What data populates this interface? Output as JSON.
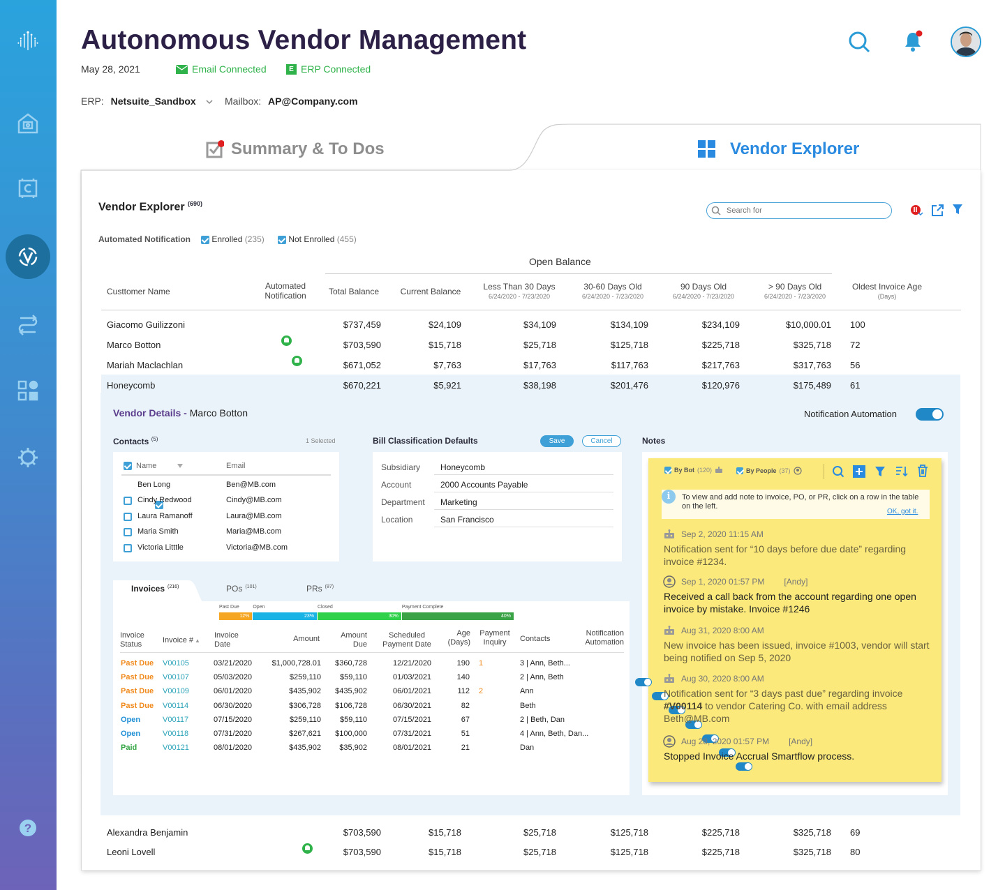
{
  "app": {
    "title": "Autonomous Vendor Management",
    "date": "May 28, 2021",
    "email_status": "Email Connected",
    "erp_status": "ERP Connected",
    "erp_badge": "E",
    "erp_label": "ERP:",
    "erp_value": "Netsuite_Sandbox",
    "mailbox_label": "Mailbox:",
    "mailbox_value": "AP@Company.com"
  },
  "tabs": {
    "summary": "Summary & To Dos",
    "vendor": "Vendor Explorer"
  },
  "explorer": {
    "title": "Vendor Explorer",
    "count": "(690)",
    "search_placeholder": "Search for",
    "filter_label": "Automated Notification",
    "enrolled": "Enrolled",
    "enrolled_count": "(235)",
    "not_enrolled": "Not Enrolled",
    "not_enrolled_count": "(455)",
    "group_header": "Open Balance",
    "columns": {
      "name": "Custtomer Name",
      "auto1": "Automated",
      "auto2": "Notification",
      "total": "Total Balance",
      "current": "Current Balance",
      "lt30": "Less Than 30 Days",
      "lt30_sub": "6/24/2020 - 7/23/2020",
      "d3060": "30-60 Days Old",
      "d3060_sub": "6/24/2020 - 7/23/2020",
      "d90": "90 Days Old",
      "d90_sub": "6/24/2020 - 7/23/2020",
      "gt90": "> 90 Days  Old",
      "gt90_sub": "6/24/2020 - 7/23/2020",
      "oldest": "Oldest Invoice Age",
      "oldest_sub": "(Days)"
    },
    "rows": [
      {
        "name": "Giacomo Guilizzoni",
        "auto": true,
        "total": "$737,459",
        "current": "$24,109",
        "lt30": "$34,109",
        "d3060": "$134,109",
        "d90": "$234,109",
        "gt90": "$10,000.01",
        "age": "100"
      },
      {
        "name": "Marco Botton",
        "auto": true,
        "total": "$703,590",
        "current": "$15,718",
        "lt30": "$25,718",
        "d3060": "$125,718",
        "d90": "$225,718",
        "gt90": "$325,718",
        "age": "72"
      },
      {
        "name": "Mariah Maclachlan",
        "auto": false,
        "total": "$671,052",
        "current": "$7,763",
        "lt30": "$17,763",
        "d3060": "$117,763",
        "d90": "$217,763",
        "gt90": "$317,763",
        "age": "56"
      },
      {
        "name": "Honeycomb",
        "auto": false,
        "total": "$670,221",
        "current": "$5,921",
        "lt30": "$38,198",
        "d3060": "$201,476",
        "d90": "$120,976",
        "gt90": "$175,489",
        "age": "61"
      }
    ],
    "rows_after": [
      {
        "name": "Alexandra Benjamin",
        "auto": true,
        "total": "$703,590",
        "current": "$15,718",
        "lt30": "$25,718",
        "d3060": "$125,718",
        "d90": "$225,718",
        "gt90": "$325,718",
        "age": "69"
      },
      {
        "name": "Leoni Lovell",
        "auto": false,
        "total": "$703,590",
        "current": "$15,718",
        "lt30": "$25,718",
        "d3060": "$125,718",
        "d90": "$225,718",
        "gt90": "$325,718",
        "age": "80"
      }
    ]
  },
  "details": {
    "title": "Vendor Details",
    "dash": " - ",
    "vendor": "Marco Botton",
    "automation_label": "Notification Automation",
    "contacts": {
      "title": "Contacts",
      "count": "(5)",
      "selected": "1 Selected",
      "col_name": "Name",
      "col_email": "Email",
      "items": [
        {
          "name": "Ben Long",
          "email": "Ben@MB.com",
          "checked": true
        },
        {
          "name": "Cindy Redwood",
          "email": "Cindy@MB.com",
          "checked": false
        },
        {
          "name": "Laura Ramanoff",
          "email": "Laura@MB.com",
          "checked": false
        },
        {
          "name": "Maria Smith",
          "email": "Maria@MB.com",
          "checked": false
        },
        {
          "name": "Victoria Litttle",
          "email": "Victoria@MB.com",
          "checked": false
        }
      ]
    },
    "bill": {
      "title": "Bill Classification Defaults",
      "save": "Save",
      "cancel": "Cancel",
      "fields": [
        {
          "label": "Subsidiary",
          "value": "Honeycomb"
        },
        {
          "label": "Account",
          "value": "2000 Accounts Payable"
        },
        {
          "label": "Department",
          "value": "Marketing"
        },
        {
          "label": "Location",
          "value": "San Francisco"
        }
      ]
    },
    "tabs": [
      {
        "label": "Invoices",
        "count": "(216)"
      },
      {
        "label": "POs",
        "count": "(101)"
      },
      {
        "label": "PRs",
        "count": "(87)"
      }
    ],
    "status_bar": [
      {
        "label": "Past Due",
        "value": "12%",
        "pct": 12,
        "color": "#f5a623"
      },
      {
        "label": "Open",
        "value": "23%",
        "pct": 23,
        "color": "#1ab3e6"
      },
      {
        "label": "Closed",
        "value": "30%",
        "pct": 30,
        "color": "#2fd14a"
      },
      {
        "label": "Payment Complete",
        "value": "40%",
        "pct": 40,
        "color": "#3aa345"
      }
    ],
    "inv_cols": {
      "status1": "Invoice",
      "status2": "Status",
      "num": "Invoice #",
      "date1": "Invoice",
      "date2": "Date",
      "amount": "Amount",
      "due1": "Amount",
      "due2": "Due",
      "sched1": "Scheduled",
      "sched2": "Payment Date",
      "age1": "Age",
      "age2": "(Days)",
      "inq1": "Payment",
      "inq2": "Inquiry",
      "contacts": "Contacts",
      "notif1": "Notification",
      "notif2": "Automation"
    },
    "invoices": [
      {
        "status": "Past Due",
        "color": "#f08a1c",
        "num": "V00105",
        "date": "03/21/2020",
        "amount": "$1,000,728.01",
        "due": "$360,728",
        "sched": "12/21/2020",
        "age": "190",
        "inq": "1",
        "contacts": "3 | Ann, Beth..."
      },
      {
        "status": "Past Due",
        "color": "#f08a1c",
        "num": "V00107",
        "date": "05/03/2020",
        "amount": "$259,110",
        "due": "$59,110",
        "sched": "01/03/2021",
        "age": "140",
        "inq": "",
        "contacts": "2 | Ann, Beth"
      },
      {
        "status": "Past Due",
        "color": "#f08a1c",
        "num": "V00109",
        "date": "06/01/2020",
        "amount": "$435,902",
        "due": "$435,902",
        "sched": "06/01/2021",
        "age": "112",
        "inq": "2",
        "contacts": "Ann"
      },
      {
        "status": "Past Due",
        "color": "#f08a1c",
        "num": "V00114",
        "date": "06/30/2020",
        "amount": "$306,728",
        "due": "$106,728",
        "sched": "06/30/2021",
        "age": "82",
        "inq": "",
        "contacts": "Beth"
      },
      {
        "status": "Open",
        "color": "#1f8fd6",
        "num": "V00117",
        "date": "07/15/2020",
        "amount": "$259,110",
        "due": "$59,110",
        "sched": "07/15/2021",
        "age": "67",
        "inq": "",
        "contacts": "2 | Beth, Dan"
      },
      {
        "status": "Open",
        "color": "#1f8fd6",
        "num": "V00118",
        "date": "07/31/2020",
        "amount": "$267,621",
        "due": "$100,000",
        "sched": "07/31/2021",
        "age": "51",
        "inq": "",
        "contacts": "4 | Ann, Beth, Dan..."
      },
      {
        "status": "Paid",
        "color": "#2fa33f",
        "num": "V00121",
        "date": "08/01/2020",
        "amount": "$435,902",
        "due": "$35,902",
        "sched": "08/01/2021",
        "age": "21",
        "inq": "",
        "contacts": "Dan"
      }
    ],
    "notes": {
      "title": "Notes",
      "by_bot": "By Bot",
      "by_bot_count": "(120)",
      "by_people": "By People",
      "by_people_count": "(37)",
      "info": "To view and add note to invoice, PO, or PR, click on a row in the table on the left.",
      "ok": "OK, got it.",
      "items": [
        {
          "type": "bot",
          "meta": "Sep 2, 2020  11:15 AM",
          "author": "",
          "body": "Notification sent for “10 days before due date” regarding invoice #1234."
        },
        {
          "type": "person",
          "meta": "Sep 1, 2020  01:57 PM",
          "author": "[Andy]",
          "body": "Received a call back from the account regarding one open invoice by mistake. Invoice #1246"
        },
        {
          "type": "bot",
          "meta": "Aug 31, 2020  8:00 AM",
          "author": "",
          "body": "New invoice has been issued, invoice #1003, vendor will start being notified on Sep 5, 2020"
        },
        {
          "type": "bot",
          "meta": "Aug 30, 2020  8:00 AM",
          "author": "",
          "body_pre": "Notification sent for “3 days past due” regarding invoice ",
          "body_bold": "#V00114",
          "body_post": " to vendor Catering Co. with email address Beth@MB.com"
        },
        {
          "type": "person",
          "meta": "Aug 28, 2020  01:57 PM",
          "author": "[Andy]",
          "body": "Stopped Invoice Accrual  Smartflow process."
        }
      ]
    }
  },
  "colors": {
    "brand": "#2c2046",
    "accent": "#2a8ae0",
    "success": "#2fb24a",
    "warning": "#f08a1c",
    "note": "#fbe97c"
  }
}
